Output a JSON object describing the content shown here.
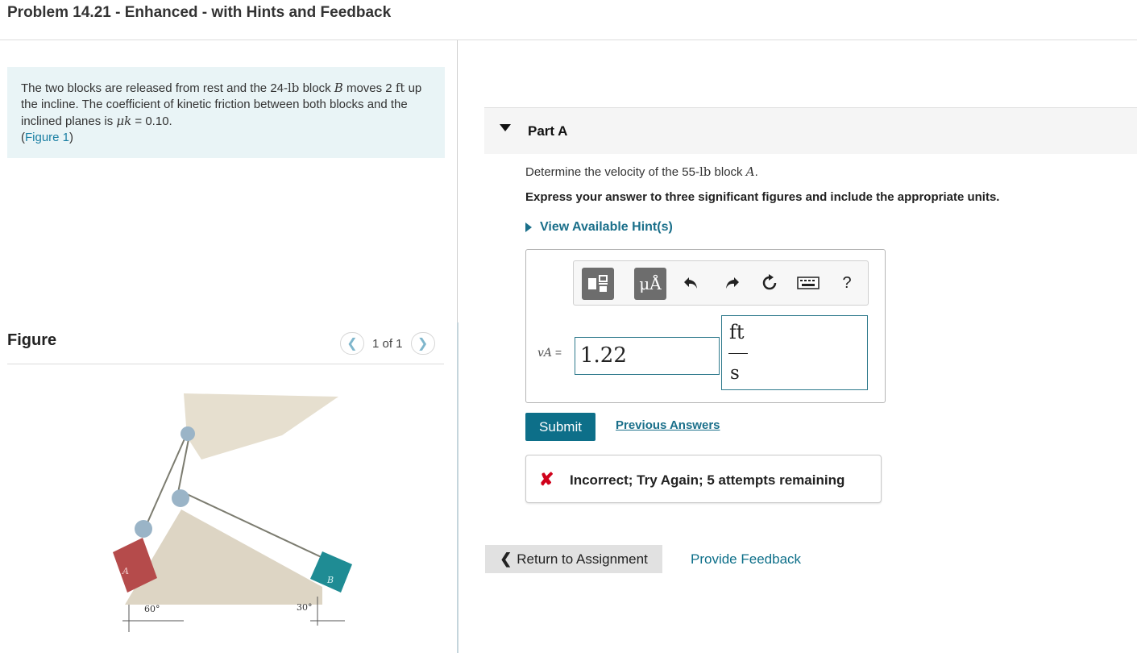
{
  "header": {
    "title": "Problem 14.21 - Enhanced - with Hints and Feedback"
  },
  "problem": {
    "text_1": "The two blocks are released from rest and the 24-",
    "unit_lb": "lb",
    "text_2": " block ",
    "block_b": "B",
    "text_3": " moves 2 ",
    "unit_ft": "ft",
    "text_4": " up the incline. The coefficient of kinetic friction between both blocks and the inclined planes is ",
    "mu_symbol": "μk",
    "text_5": " = 0.10.",
    "figure_link_open": "(",
    "figure_link": "Figure 1",
    "figure_link_close": ")"
  },
  "figure": {
    "label": "Figure",
    "pager": "1 of 1",
    "prev_icon": "chevron-left-icon",
    "next_icon": "chevron-right-icon",
    "block_a_label": "A",
    "block_b_label": "B",
    "angle_left": "60°",
    "angle_right": "30°",
    "colors": {
      "block_a": "#b54b4b",
      "block_b": "#1f8c94",
      "incline": "#ddd5c4",
      "ceiling": "#e6dfcf"
    }
  },
  "part": {
    "title": "Part A",
    "question_1": "Determine the velocity of the 55-",
    "question_unit": "lb",
    "question_2": " block ",
    "question_block": "A",
    "question_3": ".",
    "instructions": "Express your answer to three significant figures and include the appropriate units.",
    "hints": "View Available Hint(s)"
  },
  "answer": {
    "toolbar": {
      "templates_icon": "templates-icon",
      "units_label": "μÅ",
      "undo_icon": "undo-icon",
      "redo_icon": "redo-icon",
      "reset_icon": "reset-icon",
      "keyboard_icon": "keyboard-icon",
      "help_label": "?"
    },
    "variable": "vA",
    "equals": "=",
    "value": "1.22",
    "unit_numerator": "ft",
    "unit_denominator": "s"
  },
  "actions": {
    "submit": "Submit",
    "previous_answers": "Previous Answers"
  },
  "feedback": {
    "symbol": "✘",
    "message": "Incorrect; Try Again; 5 attempts remaining",
    "color": "#d0021b"
  },
  "footer": {
    "return": "Return to Assignment",
    "provide_feedback": "Provide Feedback"
  }
}
